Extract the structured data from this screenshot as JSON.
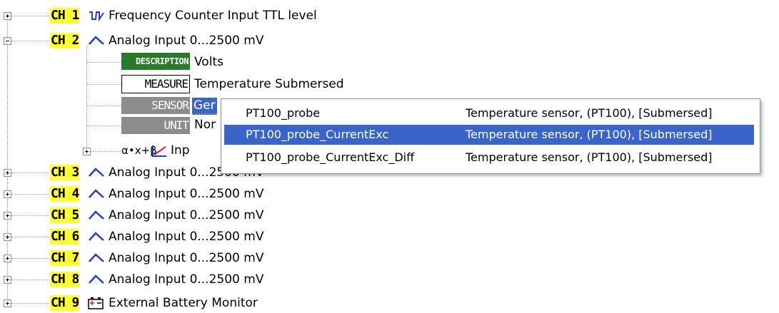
{
  "channels": [
    {
      "id": "CH 1",
      "icon": "frequency-wave-icon",
      "label": "Frequency Counter Input TTL level",
      "expanded": false
    },
    {
      "id": "CH 2",
      "icon": "analog-wave-icon",
      "label": "Analog Input 0...2500 mV",
      "expanded": true
    },
    {
      "id": "CH 3",
      "icon": "analog-wave-icon",
      "label": "Analog Input 0...2500 mV",
      "expanded": false
    },
    {
      "id": "CH 4",
      "icon": "analog-wave-icon",
      "label": "Analog Input 0...2500 mV",
      "expanded": false
    },
    {
      "id": "CH 5",
      "icon": "analog-wave-icon",
      "label": "Analog Input 0...2500 mV",
      "expanded": false
    },
    {
      "id": "CH 6",
      "icon": "analog-wave-icon",
      "label": "Analog Input 0...2500 mV",
      "expanded": false
    },
    {
      "id": "CH 7",
      "icon": "analog-wave-icon",
      "label": "Analog Input 0...2500 mV",
      "expanded": false
    },
    {
      "id": "CH 8",
      "icon": "analog-wave-icon",
      "label": "Analog Input 0...2500 mV",
      "expanded": false
    },
    {
      "id": "CH 9",
      "icon": "battery-icon",
      "label": "External Battery Monitor",
      "expanded": false
    }
  ],
  "ch2_children": {
    "description": {
      "tag": "DESCRIPTION",
      "value": "Volts"
    },
    "measure": {
      "tag": "MEASURE",
      "value": "Temperature Submersed"
    },
    "sensor": {
      "tag": "SENSOR",
      "value": "Ger"
    },
    "unit": {
      "tag": "UNIT",
      "value": "Nor"
    },
    "formula": {
      "label": "α•x+β",
      "value": "Inp"
    }
  },
  "dropdown": {
    "options": [
      {
        "name": "PT100_probe",
        "description": "Temperature sensor, (PT100), [Submersed]",
        "selected": false
      },
      {
        "name": "PT100_probe_CurrentExc",
        "description": "Temperature sensor, (PT100), [Submersed]",
        "selected": true
      },
      {
        "name": "PT100_probe_CurrentExc_Diff",
        "description": "Temperature sensor, (PT100), [Submersed]",
        "selected": false
      }
    ]
  },
  "colors": {
    "ch_highlight": "#ffff33",
    "wave_blue": "#1f3fd0",
    "selection": "#3a64c8",
    "description_tag": "#2a7a2a",
    "sensor_tag": "#8c8c8c"
  }
}
